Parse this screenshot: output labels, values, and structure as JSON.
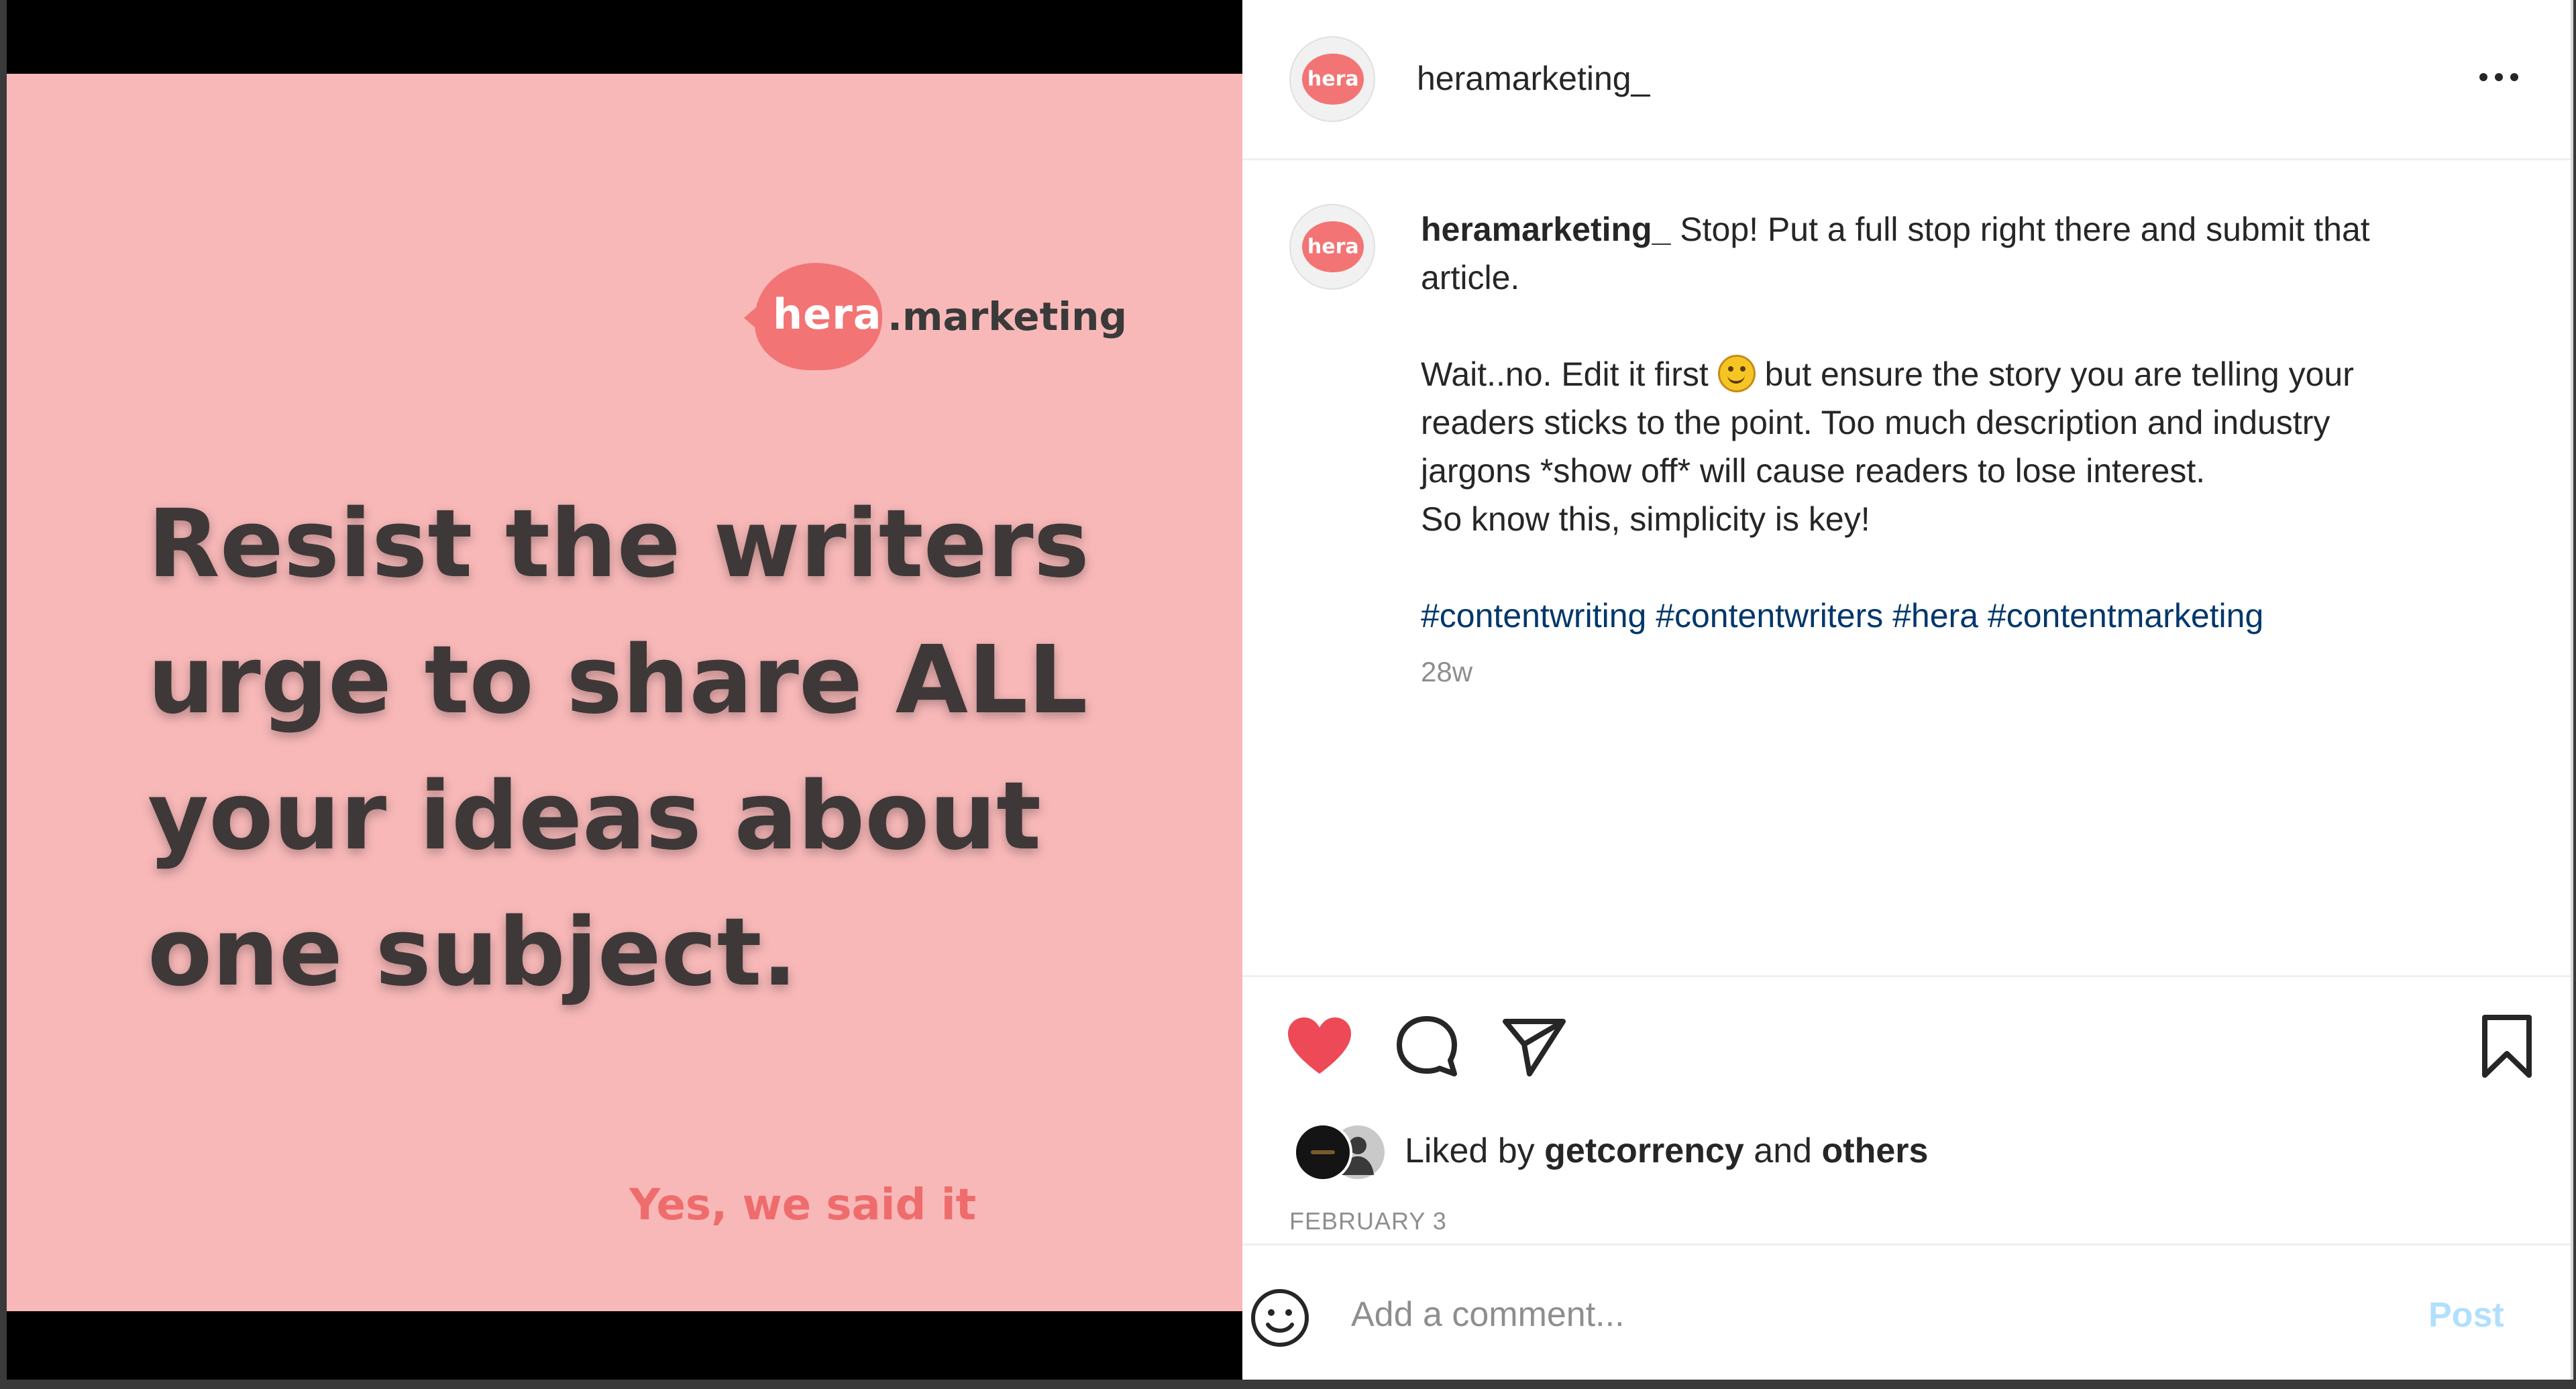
{
  "slide": {
    "brand_name": "hera",
    "brand_suffix": ".marketing",
    "headline_lines": [
      "Resist the writers",
      "urge to share ALL",
      "your ideas about",
      "one subject."
    ],
    "tagline": "Yes, we said it"
  },
  "post": {
    "username": "heramarketing_",
    "avatar_text": "hera",
    "more_icon": "more-horizontal-icon",
    "caption": {
      "owner": "heramarketing_",
      "line1_after_owner": " Stop! Put a full stop right there and submit that",
      "line2": "article.",
      "para2_line1_before_emoji": "Wait..no. Edit it first ",
      "para2_line1_after_emoji": " but ensure the story you are telling your",
      "para2_line2": "readers sticks to the point. Too much description and industry",
      "para2_line3": "jargons *show off* will cause readers to lose interest.",
      "para2_line4": "So know this, simplicity is key!",
      "hashtags": "#contentwriting #contentwriters #hera #contentmarketing"
    },
    "time_ago": "28w",
    "actions": {
      "like_icon": "heart-filled-icon",
      "comment_icon": "comment-icon",
      "share_icon": "paper-plane-icon",
      "save_icon": "bookmark-icon",
      "like_color": "#ed4956"
    },
    "likes": {
      "prefix": "Liked by ",
      "user": "getcorrency",
      "middle": " and ",
      "others": "others"
    },
    "date": "FEBRUARY 3",
    "comment": {
      "placeholder": "Add a comment...",
      "post_label": "Post",
      "emoji_icon": "smiley-icon"
    }
  },
  "colors": {
    "slide_bg": "#f8b8b8",
    "brand_coral": "#f37474",
    "headline": "#3f3838",
    "hashtag": "#00376b",
    "post_button_disabled": "#b2dffc"
  }
}
